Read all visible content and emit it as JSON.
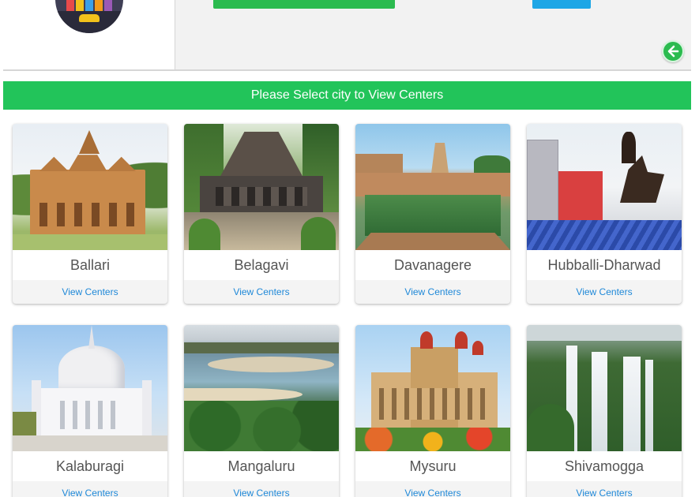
{
  "header": {
    "back_icon": "arrow-left-icon",
    "logo_icon": "city-skyline-logo"
  },
  "banner": {
    "text": "Please Select city to View Centers"
  },
  "cities": [
    {
      "name": "Ballari",
      "action": "View Centers"
    },
    {
      "name": "Belagavi",
      "action": "View Centers"
    },
    {
      "name": "Davanagere",
      "action": "View Centers"
    },
    {
      "name": "Hubballi-Dharwad",
      "action": "View Centers"
    },
    {
      "name": "Kalaburagi",
      "action": "View Centers"
    },
    {
      "name": "Mangaluru",
      "action": "View Centers"
    },
    {
      "name": "Mysuru",
      "action": "View Centers"
    },
    {
      "name": "Shivamogga",
      "action": "View Centers"
    }
  ],
  "colors": {
    "brand_green": "#22c45a",
    "link_blue": "#1e88d8",
    "accent_blue": "#1ea6e6"
  }
}
